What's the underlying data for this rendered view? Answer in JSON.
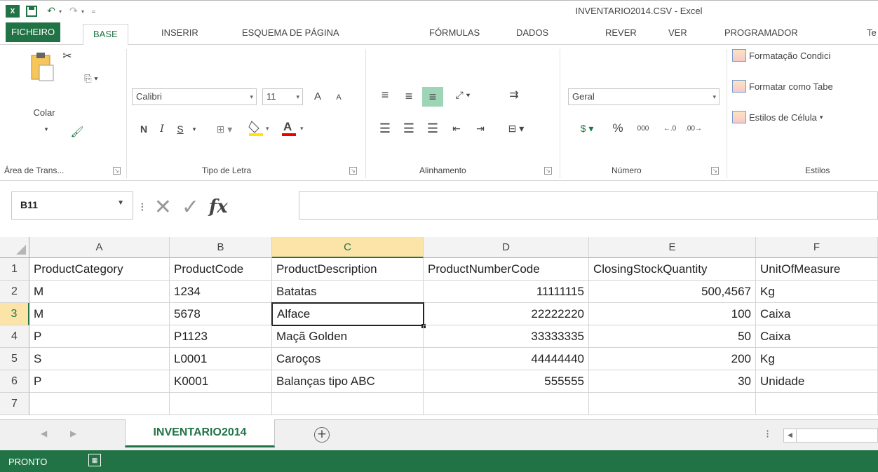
{
  "window": {
    "title": "INVENTARIO2014.CSV - Excel"
  },
  "colors": {
    "accent": "#217346",
    "active_col": "#fce4a8"
  },
  "ribbon_tabs": [
    {
      "label": "FICHEIRO"
    },
    {
      "label": "BASE"
    },
    {
      "label": "INSERIR"
    },
    {
      "label": "ESQUEMA DE PÁGINA"
    },
    {
      "label": "FÓRMULAS"
    },
    {
      "label": "DADOS"
    },
    {
      "label": "REVER"
    },
    {
      "label": "VER"
    },
    {
      "label": "PROGRAMADOR"
    },
    {
      "label": "Te"
    }
  ],
  "clipboard": {
    "paste": "Colar",
    "group": "Área de Trans..."
  },
  "font": {
    "name": "Calibri",
    "size": "11",
    "bold": "N",
    "italic": "I",
    "underline": "S",
    "color_a": "A",
    "group": "Tipo de Letra",
    "grow": "A",
    "shrink": "A"
  },
  "alignment": {
    "group": "Alinhamento"
  },
  "number": {
    "format": "Geral",
    "percent": "%",
    "thousands": "000",
    "group": "Número"
  },
  "styles": {
    "conditional": "Formatação Condici",
    "as_table": "Formatar como Tabe",
    "cell_styles": "Estilos de Célula",
    "group": "Estilos"
  },
  "formula_bar": {
    "name_box": "B11",
    "fx": "fx",
    "value": ""
  },
  "grid": {
    "columns": [
      "A",
      "B",
      "C",
      "D",
      "E",
      "F"
    ],
    "selected_column": "C",
    "selected_row": "3",
    "rows": [
      {
        "n": "1",
        "cells": [
          "ProductCategory",
          "ProductCode",
          "ProductDescription",
          "ProductNumberCode",
          "ClosingStockQuantity",
          "UnitOfMeasure"
        ]
      },
      {
        "n": "2",
        "cells": [
          "M",
          "1234",
          "Batatas",
          "11111115",
          "500,4567",
          "Kg"
        ]
      },
      {
        "n": "3",
        "cells": [
          "M",
          "5678",
          "Alface",
          "22222220",
          "100",
          "Caixa"
        ]
      },
      {
        "n": "4",
        "cells": [
          "P",
          "P1123",
          "Maçã Golden",
          "33333335",
          "50",
          "Caixa"
        ]
      },
      {
        "n": "5",
        "cells": [
          "S",
          "L0001",
          "Caroços",
          "44444440",
          "200",
          "Kg"
        ]
      },
      {
        "n": "6",
        "cells": [
          "P",
          "K0001",
          "Balanças tipo ABC",
          "555555",
          "30",
          "Unidade"
        ]
      },
      {
        "n": "7",
        "cells": [
          "",
          "",
          "",
          "",
          "",
          ""
        ]
      }
    ]
  },
  "sheets": {
    "active": "INVENTARIO2014",
    "add": "+"
  },
  "status": {
    "text": "PRONTO"
  }
}
